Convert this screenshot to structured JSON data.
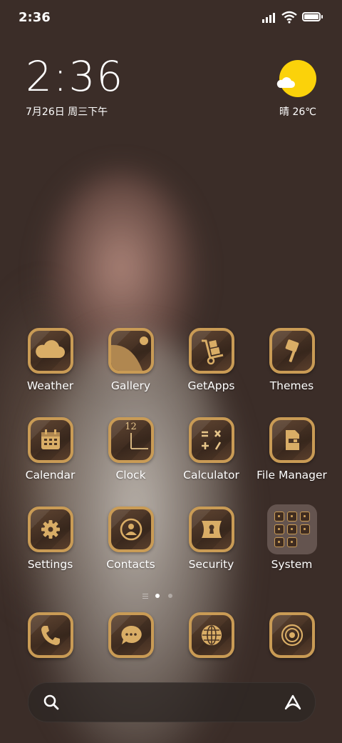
{
  "status_bar": {
    "time": "2:36"
  },
  "clock_widget": {
    "time": "2:36",
    "date": "7月26日 周三下午"
  },
  "weather_widget": {
    "text": "晴 26℃",
    "icon": "sun-cloud-icon"
  },
  "apps_row1": [
    {
      "label": "Weather",
      "icon": "cloud-icon"
    },
    {
      "label": "Gallery",
      "icon": "gallery-icon"
    },
    {
      "label": "GetApps",
      "icon": "hand-truck-icon"
    },
    {
      "label": "Themes",
      "icon": "paint-brush-icon"
    }
  ],
  "apps_row2": [
    {
      "label": "Calendar",
      "icon": "calendar-icon"
    },
    {
      "label": "Clock",
      "icon": "clock-face-icon",
      "face_number": "12"
    },
    {
      "label": "Calculator",
      "icon": "calculator-icon"
    },
    {
      "label": "File Manager",
      "icon": "folder-file-icon"
    }
  ],
  "apps_row3": [
    {
      "label": "Settings",
      "icon": "gear-icon"
    },
    {
      "label": "Contacts",
      "icon": "person-icon"
    },
    {
      "label": "Security",
      "icon": "shield-lock-icon"
    },
    {
      "label": "System",
      "icon": "folder-grid-icon"
    }
  ],
  "dock": [
    {
      "icon": "phone-icon"
    },
    {
      "icon": "message-icon"
    },
    {
      "icon": "globe-icon"
    },
    {
      "icon": "camera-icon"
    }
  ],
  "page_indicator": {
    "count": 2,
    "active": 0
  },
  "search_bar": {
    "left_icon": "search-icon",
    "right_icon": "assistant-icon"
  },
  "colors": {
    "background": "#3b2d28",
    "icon_frame": "#c99b55",
    "sun": "#fbd20a"
  }
}
